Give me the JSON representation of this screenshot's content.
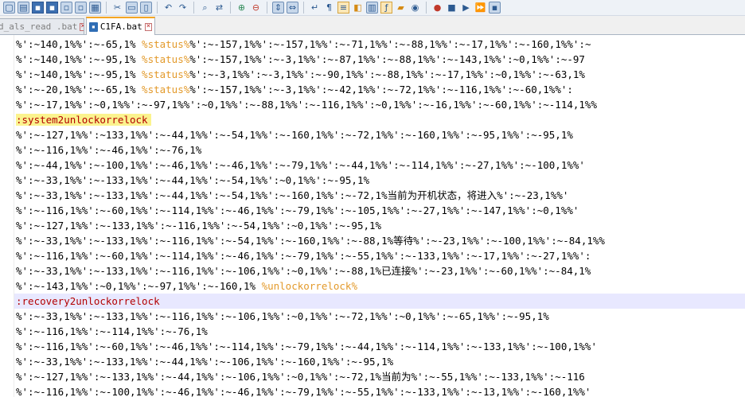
{
  "tabs": [
    {
      "label": "d_als_read .bat",
      "active": false
    },
    {
      "label": "C1FA.bat",
      "active": true
    }
  ],
  "toolbar": {
    "icons": [
      "new-file-icon",
      "open-file-icon",
      "save-icon",
      "save-all-icon",
      "close-icon",
      "close-all-icon",
      "print-icon",
      "cut-icon",
      "copy-icon",
      "paste-icon",
      "undo-icon",
      "redo-icon",
      "find-icon",
      "replace-icon",
      "zoom-in-icon",
      "zoom-out-icon",
      "sync-v-icon",
      "sync-h-icon",
      "wrap-icon",
      "show-all-icon",
      "indent-guide-icon",
      "udl-icon",
      "doc-map-icon",
      "function-list-icon",
      "folder-icon",
      "monitor-icon",
      "record-icon",
      "stop-icon",
      "play-icon",
      "play-multi-icon",
      "save-macro-icon"
    ]
  },
  "lines": [
    [
      {
        "t": "%':~140,1%%':~-65,1% "
      },
      {
        "t": "%status%",
        "c": "var"
      },
      {
        "t": "%':~-157,1%%':~-157,1%%':~-71,1%%':~-88,1%%':~-17,1%%':~-160,1%%':~"
      }
    ],
    [
      {
        "t": "%':~140,1%%':~-95,1% "
      },
      {
        "t": "%status%",
        "c": "var"
      },
      {
        "t": "%':~-157,1%%':~-3,1%%':~-87,1%%':~-88,1%%':~-143,1%%':~0,1%%':~-97"
      }
    ],
    [
      {
        "t": "%':~140,1%%':~-95,1% "
      },
      {
        "t": "%status%",
        "c": "var"
      },
      {
        "t": "%':~-3,1%%':~-3,1%%':~-90,1%%':~-88,1%%':~-17,1%%':~0,1%%':~-63,1%"
      }
    ],
    [
      {
        "t": "%':~-20,1%%':~-65,1% "
      },
      {
        "t": "%status%",
        "c": "var"
      },
      {
        "t": "%':~-157,1%%':~-3,1%%':~-42,1%%':~-72,1%%':~-116,1%%':~-60,1%%':"
      }
    ],
    [
      {
        "t": "%':~-17,1%%':~0,1%%':~-97,1%%':~0,1%%':~-88,1%%':~-116,1%%':~0,1%%':~-16,1%%':~-60,1%%':~-114,1%%"
      }
    ],
    [
      {
        "t": ":system2unlockorrelock",
        "c": "label",
        "hl": true
      }
    ],
    [
      {
        "t": "%':~-127,1%%':~133,1%%':~-44,1%%':~-54,1%%':~-160,1%%':~-72,1%%':~-160,1%%':~-95,1%%':~-95,1%"
      }
    ],
    [
      {
        "t": "%':~-116,1%%':~-46,1%%':~-76,1%"
      }
    ],
    [
      {
        "t": "%':~-44,1%%':~-100,1%%':~-46,1%%':~-46,1%%':~-79,1%%':~-44,1%%':~-114,1%%':~-27,1%%':~-100,1%%'"
      }
    ],
    [
      {
        "t": "%':~-33,1%%':~-133,1%%':~-44,1%%':~-54,1%%':~0,1%%':~-95,1%"
      }
    ],
    [
      {
        "t": "%':~-33,1%%':~-133,1%%':~-44,1%%':~-54,1%%':~-160,1%%':~-72,1%当前为开机状态，将进入%':~-23,1%%'"
      }
    ],
    [
      {
        "t": "%':~-116,1%%':~-60,1%%':~-114,1%%':~-46,1%%':~-79,1%%':~-105,1%%':~-27,1%%':~-147,1%%':~0,1%%'"
      }
    ],
    [
      {
        "t": "%':~-127,1%%':~-133,1%%':~-116,1%%':~-54,1%%':~0,1%%':~-95,1%"
      }
    ],
    [
      {
        "t": "%':~-33,1%%':~-133,1%%':~-116,1%%':~-54,1%%':~-160,1%%':~-88,1%等待%':~-23,1%%':~-100,1%%':~-84,1%%"
      }
    ],
    [
      {
        "t": "%':~-116,1%%':~-60,1%%':~-114,1%%':~-46,1%%':~-79,1%%':~-55,1%%':~-133,1%%':~-17,1%%':~-27,1%%':"
      }
    ],
    [
      {
        "t": "%':~-33,1%%':~-133,1%%':~-116,1%%':~-106,1%%':~0,1%%':~-88,1%已连接%':~-23,1%%':~-60,1%%':~-84,1%"
      }
    ],
    [
      {
        "t": "%':~-143,1%%':~0,1%%':~-97,1%%':~-160,1% "
      },
      {
        "t": "%unlockorrelock%",
        "c": "var"
      }
    ],
    [
      {
        "t": ":recovery2unlockorrelock",
        "c": "label"
      }
    ],
    [
      {
        "t": "%':~-33,1%%':~-133,1%%':~-116,1%%':~-106,1%%':~0,1%%':~-72,1%%':~0,1%%':~-65,1%%':~-95,1%"
      }
    ],
    [
      {
        "t": "%':~-116,1%%':~-114,1%%':~-76,1%"
      }
    ],
    [
      {
        "t": "%':~-116,1%%':~-60,1%%':~-46,1%%':~-114,1%%':~-79,1%%':~-44,1%%':~-114,1%%':~-133,1%%':~-100,1%%'"
      }
    ],
    [
      {
        "t": "%':~-33,1%%':~-133,1%%':~-44,1%%':~-106,1%%':~-160,1%%':~-95,1%"
      }
    ],
    [
      {
        "t": "%':~-127,1%%':~-133,1%%':~-44,1%%':~-106,1%%':~0,1%%':~-72,1%当前为%':~-55,1%%':~-133,1%%':~-116"
      }
    ],
    [
      {
        "t": "%':~-116,1%%':~-100,1%%':~-46,1%%':~-46,1%%':~-79,1%%':~-55,1%%':~-133,1%%':~-13,1%%':~-160,1%%'"
      }
    ]
  ],
  "current_line_index": 17
}
